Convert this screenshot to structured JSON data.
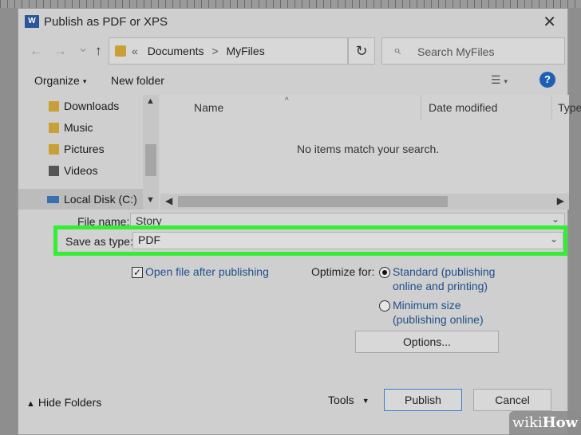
{
  "window": {
    "app_icon_letter": "W",
    "title": "Publish as PDF or XPS",
    "close": "✕"
  },
  "nav": {
    "back": "←",
    "forward": "→",
    "recent": "⌄",
    "up": "↑"
  },
  "address": {
    "chevron": "«",
    "crumb1": "Documents",
    "sep": ">",
    "crumb2": "MyFiles",
    "dropdown": "⌄",
    "refresh": "↻"
  },
  "search": {
    "placeholder": "Search MyFiles"
  },
  "toolbar": {
    "organize": "Organize",
    "new_folder": "New folder",
    "view": "☰",
    "help": "?"
  },
  "sidebar": {
    "items": [
      {
        "label": "Downloads",
        "icon": "downloads-icon",
        "color": "#c8a035"
      },
      {
        "label": "Music",
        "icon": "music-icon",
        "color": "#c8a035"
      },
      {
        "label": "Pictures",
        "icon": "pictures-icon",
        "color": "#c8a035"
      },
      {
        "label": "Videos",
        "icon": "videos-icon",
        "color": "#555555"
      },
      {
        "label": "Local Disk (C:)",
        "icon": "drive-icon",
        "color": "#3a6fb0"
      }
    ]
  },
  "file_list": {
    "columns": [
      "Name",
      "Date modified",
      "Type"
    ],
    "empty_message": "No items match your search."
  },
  "form": {
    "file_name_label": "File name:",
    "file_name_value": "Story",
    "save_as_type_label": "Save as type:",
    "save_as_type_value": "PDF"
  },
  "options": {
    "open_after_publishing": "Open file after publishing",
    "open_after_checked": true,
    "optimize_label": "Optimize for:",
    "standard_line1": "Standard (publishing",
    "standard_line2": "online and printing)",
    "minimum_line1": "Minimum size",
    "minimum_line2": "(publishing online)",
    "options_button": "Options..."
  },
  "footer": {
    "hide_folders": "Hide Folders",
    "tools": "Tools",
    "publish": "Publish",
    "cancel": "Cancel"
  },
  "watermark": {
    "wiki": "wiki",
    "how": "How"
  }
}
